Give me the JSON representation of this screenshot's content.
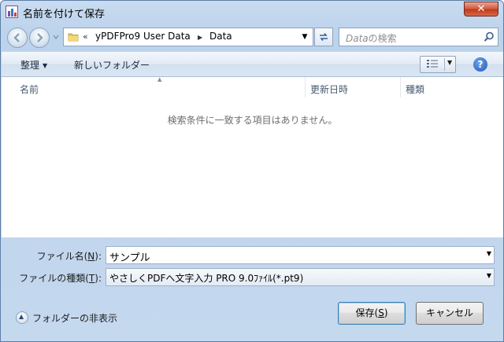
{
  "window": {
    "title": "名前を付けて保存",
    "close_label": "✕"
  },
  "address": {
    "overflow_chevron": "«",
    "separator": "▶",
    "crumbs": [
      "yPDFPro9 User Data",
      "Data"
    ]
  },
  "search": {
    "placeholder_em": "Data",
    "placeholder_rest": "の検索"
  },
  "toolbar": {
    "organize_label": "整理",
    "new_folder_label": "新しいフォルダー",
    "help_label": "?"
  },
  "list": {
    "columns": [
      "名前",
      "更新日時",
      "種類"
    ],
    "empty_message": "検索条件に一致する項目はありません。"
  },
  "form": {
    "filename_label_pre": "ファイル名(",
    "filename_label_key": "N",
    "filename_label_post": "):",
    "filename_value": "サンプル",
    "filetype_label_pre": "ファイルの種類(",
    "filetype_label_key": "T",
    "filetype_label_post": "):",
    "filetype_value": "やさしくPDFへ文字入力 PRO 9.0ﾌｧｲﾙ(*.pt9)"
  },
  "footer": {
    "hide_folders_label": "フォルダーの非表示",
    "save_pre": "保存(",
    "save_key": "S",
    "save_post": ")",
    "cancel_label": "キャンセル"
  },
  "colors": {
    "accent": "#3c7fb1",
    "close_red": "#c23a1d",
    "frame": "#bcd3ec"
  }
}
